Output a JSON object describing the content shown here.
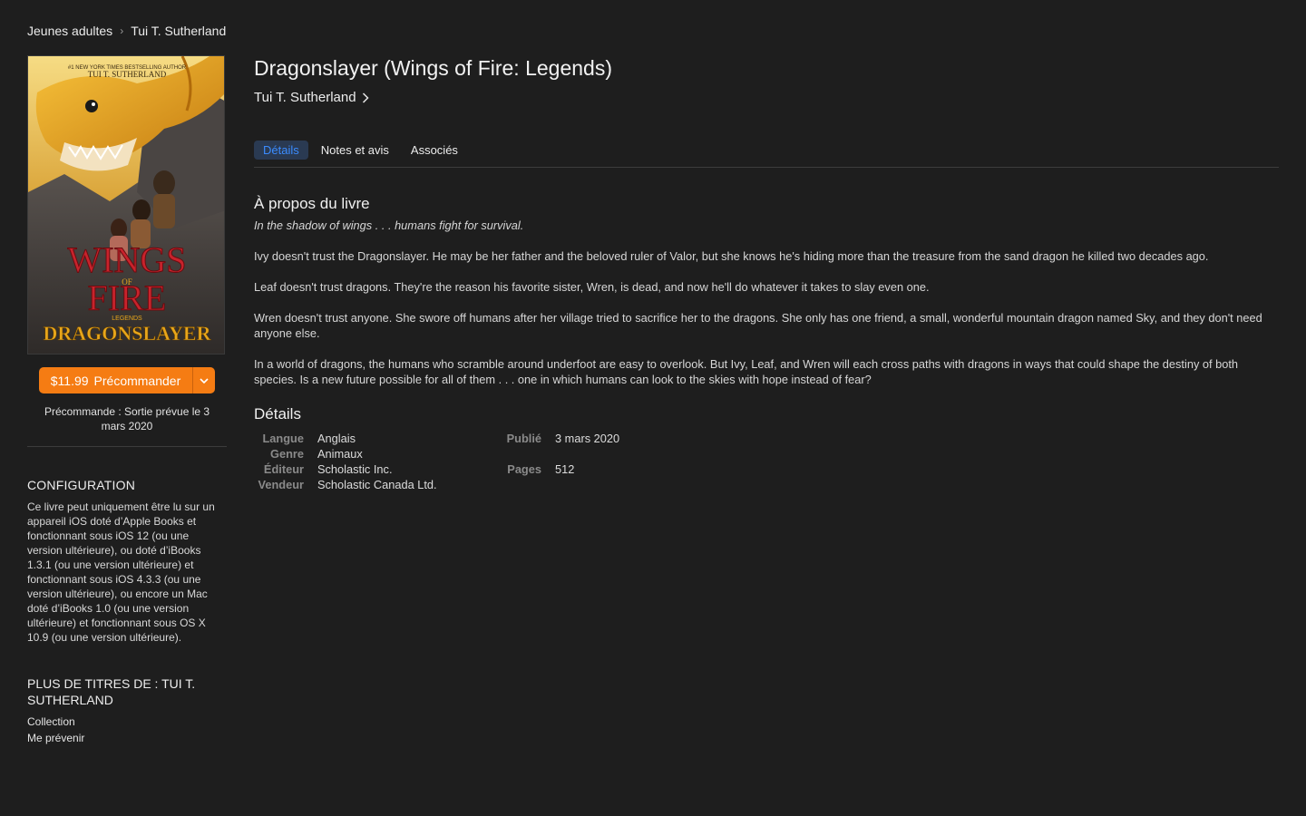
{
  "breadcrumb": {
    "category": "Jeunes adultes",
    "author": "Tui T. Sutherland"
  },
  "cover": {
    "tagline": "#1 NEW YORK TIMES BESTSELLING AUTHOR",
    "author": "TUI T. SUTHERLAND",
    "series_line1": "WINGS",
    "series_of": "OF",
    "series_line2": "FIRE",
    "subseries": "LEGENDS",
    "title": "DRAGONSLAYER",
    "colors": {
      "dragon": "#e8a61a",
      "title": "#e8a61a",
      "series": "#c8232c",
      "sky": "#f2d273",
      "rock": "#3e3b3a"
    }
  },
  "purchase": {
    "price": "$11.99",
    "label": "Précommander",
    "note": "Précommande : Sortie prévue le 3 mars 2020"
  },
  "sidebar": {
    "config_heading": "CONFIGURATION",
    "config_text": "Ce livre peut uniquement être lu sur un appareil iOS doté d’Apple Books et fonctionnant sous iOS 12 (ou une version ultérieure), ou doté d’iBooks 1.3.1 (ou une version ultérieure) et fonctionnant sous iOS 4.3.3 (ou une version ultérieure), ou encore un Mac doté d’iBooks 1.0 (ou une version ultérieure) et fonctionnant sous OS X 10.9 (ou une version ultérieure).",
    "more_heading": "PLUS DE TITRES DE : TUI T. SUTHERLAND",
    "links": [
      "Collection",
      "Me prévenir"
    ]
  },
  "book": {
    "title": "Dragonslayer (Wings of Fire: Legends)",
    "author": "Tui T. Sutherland"
  },
  "tabs": [
    {
      "label": "Détails",
      "active": true
    },
    {
      "label": "Notes et avis",
      "active": false
    },
    {
      "label": "Associés",
      "active": false
    }
  ],
  "about": {
    "heading": "À propos du livre",
    "lead": "In the shadow of wings . . . humans fight for survival.",
    "paragraphs": [
      "Ivy doesn't trust the Dragonslayer. He may be her father and the beloved ruler of Valor, but she knows he's hiding more than the treasure from the sand dragon he killed two decades ago.",
      "Leaf doesn't trust dragons. They're the reason his favorite sister, Wren, is dead, and now he'll do whatever it takes to slay even one.",
      "Wren doesn't trust anyone. She swore off humans after her village tried to sacrifice her to the dragons. She only has one friend, a small, wonderful mountain dragon named Sky, and they don't need anyone else.",
      "In a world of dragons, the humans who scramble around underfoot are easy to overlook. But Ivy, Leaf, and Wren will each cross paths with dragons in ways that could shape the destiny of both species. Is a new future possible for all of them . . . one in which humans can look to the skies with hope instead of fear?"
    ]
  },
  "details": {
    "heading": "Détails",
    "left": [
      {
        "label": "Langue",
        "value": "Anglais"
      },
      {
        "label": "Genre",
        "value": "Animaux"
      },
      {
        "label": "Éditeur",
        "value": "Scholastic Inc."
      },
      {
        "label": "Vendeur",
        "value": "Scholastic Canada Ltd."
      }
    ],
    "right": [
      {
        "label": "Publié",
        "value": "3 mars 2020"
      },
      {
        "label": "Pages",
        "value": "512"
      }
    ]
  },
  "colors": {
    "background": "#1e1e1e",
    "accent": "#f57c13",
    "tab_active": "#3b8cff"
  }
}
